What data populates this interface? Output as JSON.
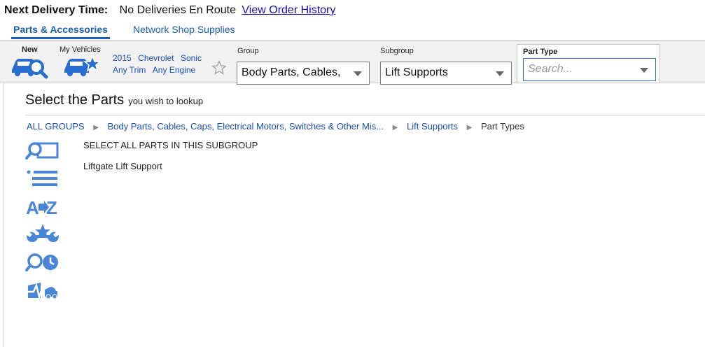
{
  "top": {
    "delivery_label": "Next Delivery Time:",
    "delivery_value": "No Deliveries En Route",
    "history_link": "View Order History"
  },
  "tabs": [
    {
      "label": "Parts & Accessories",
      "active": true
    },
    {
      "label": "Network Shop Supplies",
      "active": false
    }
  ],
  "vehicle": {
    "new_label": "New",
    "my_vehicles_label": "My Vehicles",
    "year": "2015",
    "make": "Chevrolet",
    "model": "Sonic",
    "trim": "Any Trim",
    "engine": "Any Engine"
  },
  "selectors": {
    "group": {
      "label": "Group",
      "value": "Body Parts, Cables,"
    },
    "subgroup": {
      "label": "Subgroup",
      "value": "Lift Supports"
    },
    "part_type": {
      "label": "Part Type",
      "placeholder": "Search..."
    }
  },
  "main": {
    "title": "Select the Parts",
    "subtitle": "you wish to lookup",
    "breadcrumb": {
      "all_groups": "ALL GROUPS",
      "group": "Body Parts, Cables, Caps, Electrical Motors, Switches & Other Mis...",
      "subgroup": "Lift Supports",
      "current": "Part Types"
    },
    "parts": [
      "SELECT ALL PARTS IN THIS SUBGROUP",
      "Liftgate Lift Support"
    ]
  },
  "colors": {
    "accent": "#1a5fb4",
    "icon_blue": "#4a86d6",
    "link": "#1a0dab"
  },
  "side_icons": [
    "parts-lookup-icon",
    "list-view-icon",
    "a-to-z-icon",
    "service-star-icon",
    "search-clock-icon",
    "vehicle-diagnostics-icon"
  ]
}
